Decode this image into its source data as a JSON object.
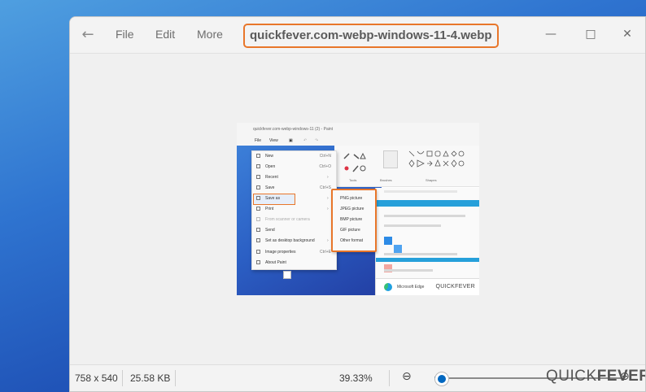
{
  "titlebar": {
    "back_icon": "arrow-left-icon",
    "menus": [
      "File",
      "Edit",
      "More"
    ],
    "filename": "quickfever.com-webp-windows-11-4.webp",
    "filename_highlight": "#e8762a",
    "window_controls": [
      "minimize-icon",
      "maximize-icon",
      "close-icon"
    ]
  },
  "statusbar": {
    "dimensions": "758 x 540",
    "file_size": "25.58 KB",
    "zoom_percent": "39.33%",
    "zoom_out_icon": "zoom-out-icon",
    "zoom_in_icon": "zoom-in-icon",
    "zoom_slider_fraction": 0.04,
    "accent": "#0067c0"
  },
  "watermark": {
    "part1": "QUICK",
    "part2": "FEVER"
  },
  "image": {
    "title": "quickfever.com-webp-windows-11 (2) - Paint",
    "menubar": [
      "File",
      "View"
    ],
    "menu_items": [
      {
        "label": "New",
        "shortcut": "Ctrl+N"
      },
      {
        "label": "Open",
        "shortcut": "Ctrl+O"
      },
      {
        "label": "Recent",
        "shortcut": ""
      },
      {
        "label": "Save",
        "shortcut": "Ctrl+S"
      },
      {
        "label": "Save as",
        "shortcut": ""
      },
      {
        "label": "Print",
        "shortcut": ""
      },
      {
        "label": "From scanner or camera",
        "shortcut": ""
      },
      {
        "label": "Send",
        "shortcut": ""
      },
      {
        "label": "Set as desktop background",
        "shortcut": ""
      },
      {
        "label": "Image properties",
        "shortcut": "Ctrl+E"
      },
      {
        "label": "About Paint",
        "shortcut": ""
      }
    ],
    "submenu": [
      "PNG picture",
      "JPEG picture",
      "BMP picture",
      "GIF picture",
      "Other format"
    ],
    "ribbon_labels": [
      "Tools",
      "Brushes",
      "Shapes"
    ],
    "footer_app": "Microsoft Edge",
    "watermark": "QUICKFEVER"
  }
}
